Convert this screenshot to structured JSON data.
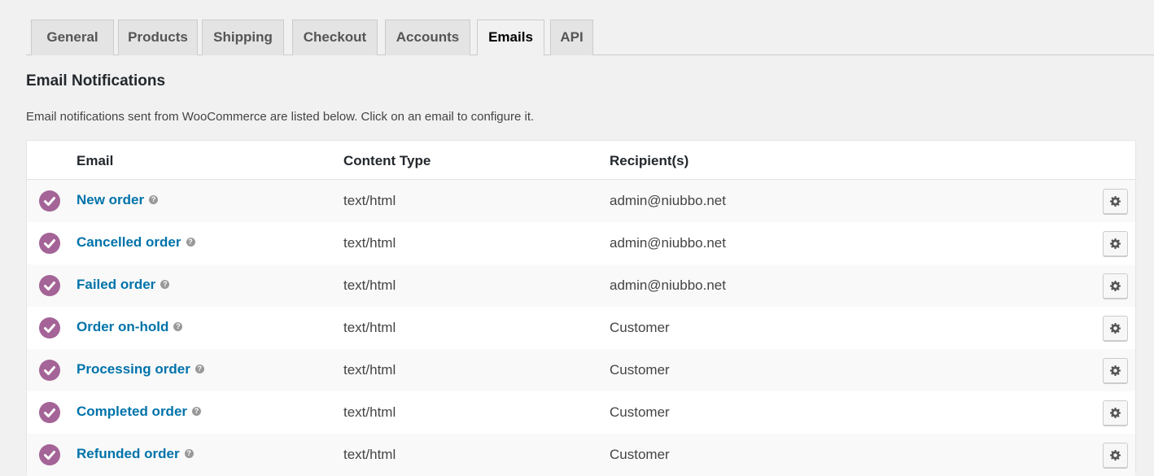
{
  "tabs": [
    {
      "label": "General",
      "active": false
    },
    {
      "label": "Products",
      "active": false
    },
    {
      "label": "Shipping",
      "active": false
    },
    {
      "label": "Checkout",
      "active": false
    },
    {
      "label": "Accounts",
      "active": false
    },
    {
      "label": "Emails",
      "active": true
    },
    {
      "label": "API",
      "active": false
    }
  ],
  "section": {
    "title": "Email Notifications",
    "description": "Email notifications sent from WooCommerce are listed below. Click on an email to configure it."
  },
  "table": {
    "headers": {
      "email": "Email",
      "content_type": "Content Type",
      "recipients": "Recipient(s)"
    },
    "rows": [
      {
        "status_icon": "enabled-check-icon",
        "name": "New order",
        "content_type": "text/html",
        "recipient": "admin@niubbo.net"
      },
      {
        "status_icon": "enabled-check-icon",
        "name": "Cancelled order",
        "content_type": "text/html",
        "recipient": "admin@niubbo.net"
      },
      {
        "status_icon": "enabled-check-icon",
        "name": "Failed order",
        "content_type": "text/html",
        "recipient": "admin@niubbo.net"
      },
      {
        "status_icon": "enabled-check-icon",
        "name": "Order on-hold",
        "content_type": "text/html",
        "recipient": "Customer"
      },
      {
        "status_icon": "enabled-check-icon",
        "name": "Processing order",
        "content_type": "text/html",
        "recipient": "Customer"
      },
      {
        "status_icon": "enabled-check-icon",
        "name": "Completed order",
        "content_type": "text/html",
        "recipient": "Customer"
      },
      {
        "status_icon": "enabled-check-icon",
        "name": "Refunded order",
        "content_type": "text/html",
        "recipient": "Customer"
      }
    ]
  },
  "icons": {
    "help": "?",
    "manage": "gear-icon"
  },
  "colors": {
    "accent_purple": "#a46497",
    "link_blue": "#0073aa",
    "background": "#f1f1f1",
    "tab_inactive": "#e4e4e4"
  }
}
